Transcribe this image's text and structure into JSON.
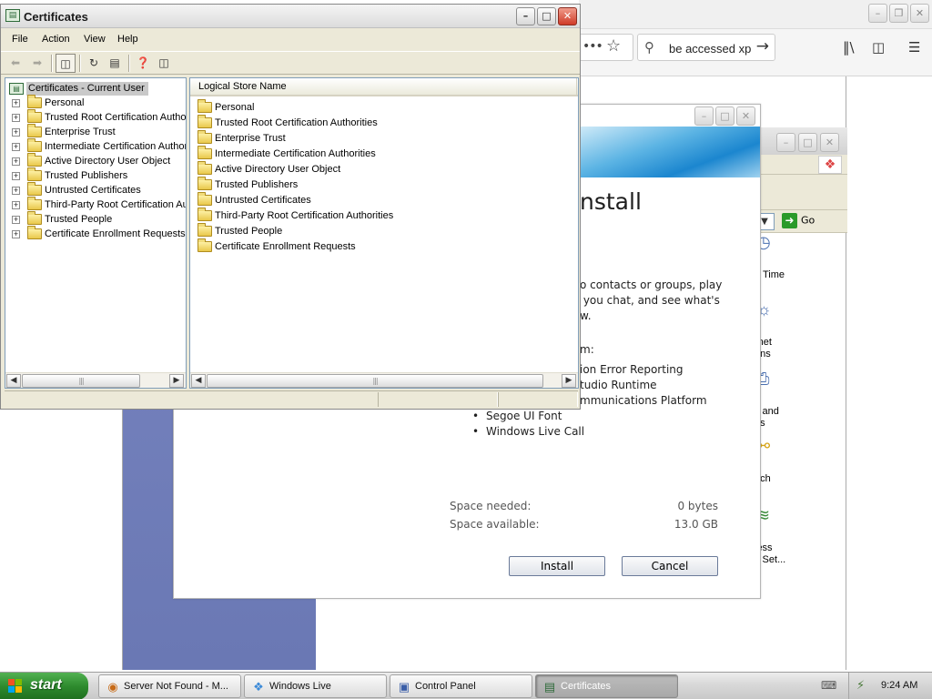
{
  "firefox": {
    "search_text": "be accessed xp"
  },
  "control_panel": {
    "go_label": "Go",
    "items": [
      {
        "icon": "clock-icon",
        "label": "d Time"
      },
      {
        "icon": "internet-options-icon",
        "label": "rnet\nons"
      },
      {
        "icon": "printers-icon",
        "label": "s and\nes"
      },
      {
        "icon": "speech-icon",
        "label": "ech"
      },
      {
        "icon": "wireless-network-icon",
        "label": "less\nk Set..."
      }
    ]
  },
  "installer": {
    "heading": "nstall",
    "description": "o contacts or groups, play\n you chat, and see what's\nw.",
    "colon_line": "m:",
    "partial_items": [
      "ion Error Reporting",
      "tudio Runtime",
      "mmunications Platform"
    ],
    "items": [
      "Segoe UI Font",
      "Windows Live Call"
    ],
    "space_needed_label": "Space needed:",
    "space_needed_value": "0 bytes",
    "space_available_label": "Space available:",
    "space_available_value": "13.0 GB",
    "install_button": "Install",
    "cancel_button": "Cancel"
  },
  "certificates": {
    "title": "Certificates",
    "menu": [
      "File",
      "Action",
      "View",
      "Help"
    ],
    "tree_root": "Certificates - Current User",
    "tree_items": [
      "Personal",
      "Trusted Root Certification Authoritie",
      "Enterprise Trust",
      "Intermediate Certification Authoritie",
      "Active Directory User Object",
      "Trusted Publishers",
      "Untrusted Certificates",
      "Third-Party Root Certification Autho",
      "Trusted People",
      "Certificate Enrollment Requests"
    ],
    "column_header": "Logical Store Name",
    "list_items": [
      "Personal",
      "Trusted Root Certification Authorities",
      "Enterprise Trust",
      "Intermediate Certification Authorities",
      "Active Directory User Object",
      "Trusted Publishers",
      "Untrusted Certificates",
      "Third-Party Root Certification Authorities",
      "Trusted People",
      "Certificate Enrollment Requests"
    ]
  },
  "taskbar": {
    "start_label": "start",
    "tasks": [
      {
        "icon": "firefox-icon",
        "label": "Server Not Found - M...",
        "active": false
      },
      {
        "icon": "windows-live-icon",
        "label": "Windows Live",
        "active": false
      },
      {
        "icon": "control-panel-icon",
        "label": "Control Panel",
        "active": false
      },
      {
        "icon": "certificates-icon",
        "label": "Certificates",
        "active": true
      }
    ],
    "clock": "9:24 AM"
  }
}
